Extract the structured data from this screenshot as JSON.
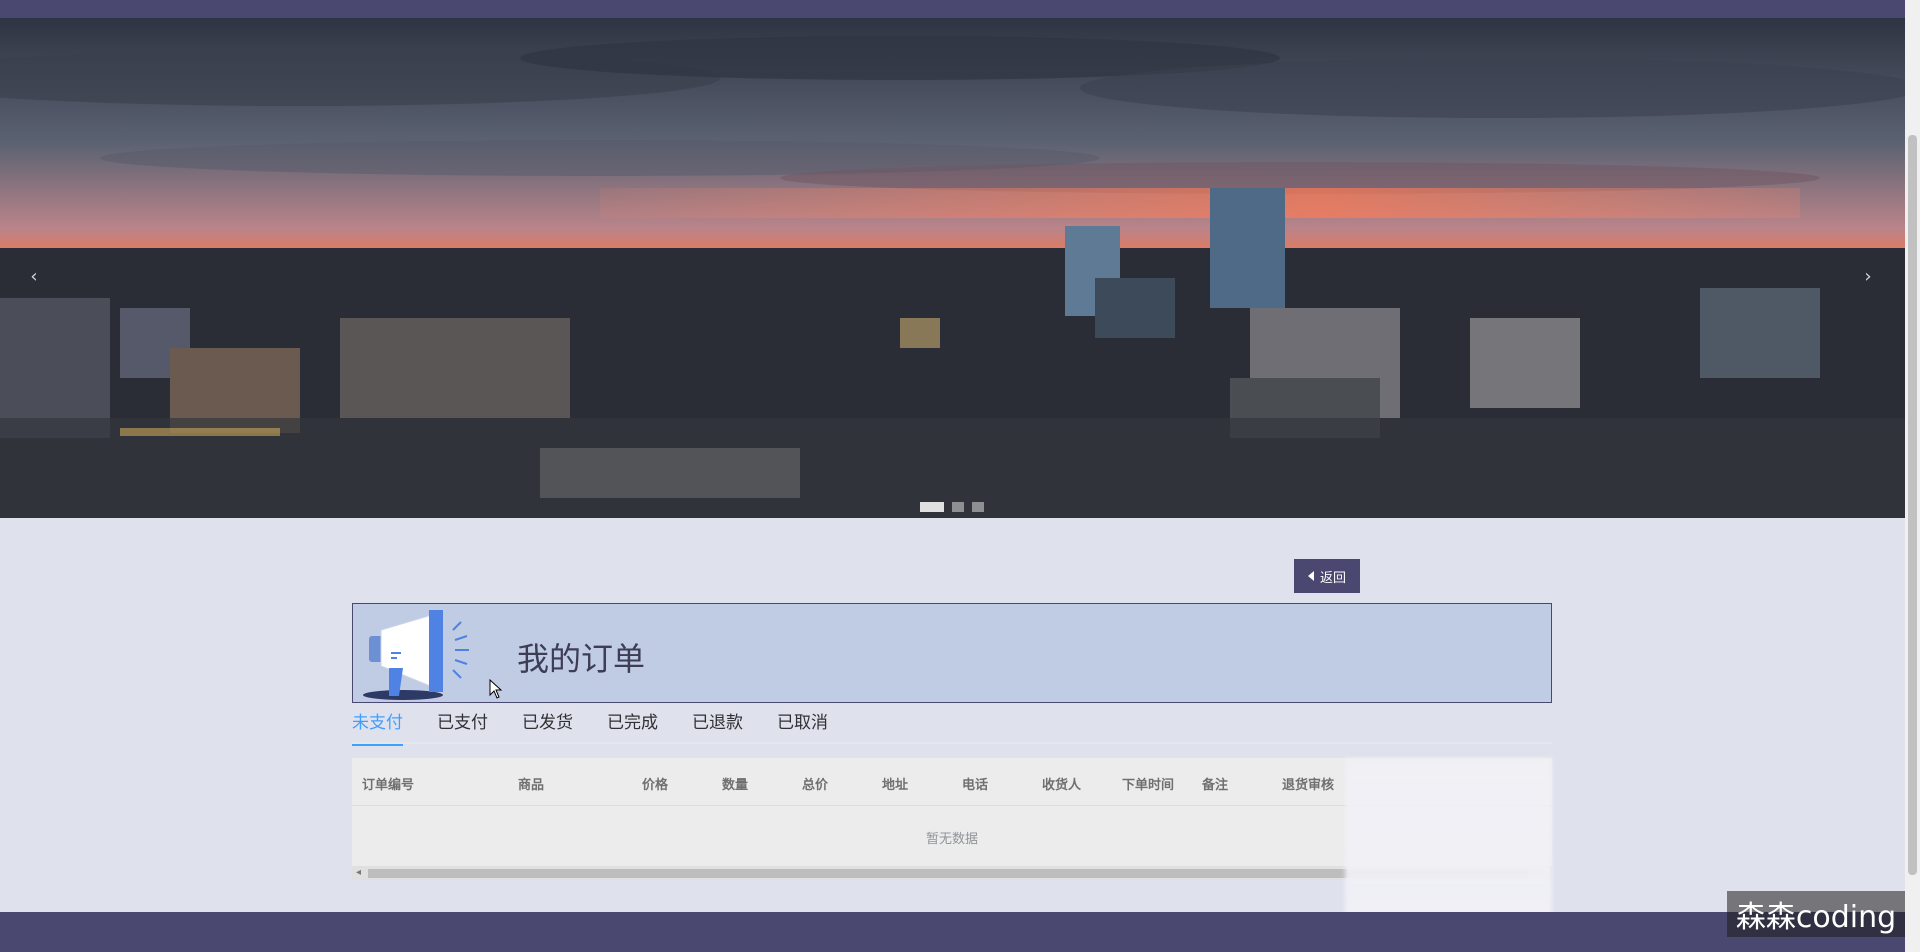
{
  "carousel": {
    "prev_symbol": "‹",
    "next_symbol": "›",
    "slide_count": 3,
    "active_slide": 1
  },
  "back_button": {
    "label": "返回"
  },
  "order_header": {
    "title": "我的订单"
  },
  "tabs": [
    {
      "label": "未支付",
      "active": true
    },
    {
      "label": "已支付",
      "active": false
    },
    {
      "label": "已发货",
      "active": false
    },
    {
      "label": "已完成",
      "active": false
    },
    {
      "label": "已退款",
      "active": false
    },
    {
      "label": "已取消",
      "active": false
    }
  ],
  "table": {
    "columns": [
      "订单编号",
      "商品",
      "价格",
      "数量",
      "总价",
      "地址",
      "电话",
      "收货人",
      "下单时间",
      "备注",
      "退货审核"
    ],
    "empty_text": "暂无数据"
  },
  "watermark": {
    "text": "森森coding"
  },
  "colors": {
    "nav": "#4a4870",
    "accent": "#409eff",
    "header_bg": "#c0cce3",
    "page_bg": "#dfe1ec"
  }
}
